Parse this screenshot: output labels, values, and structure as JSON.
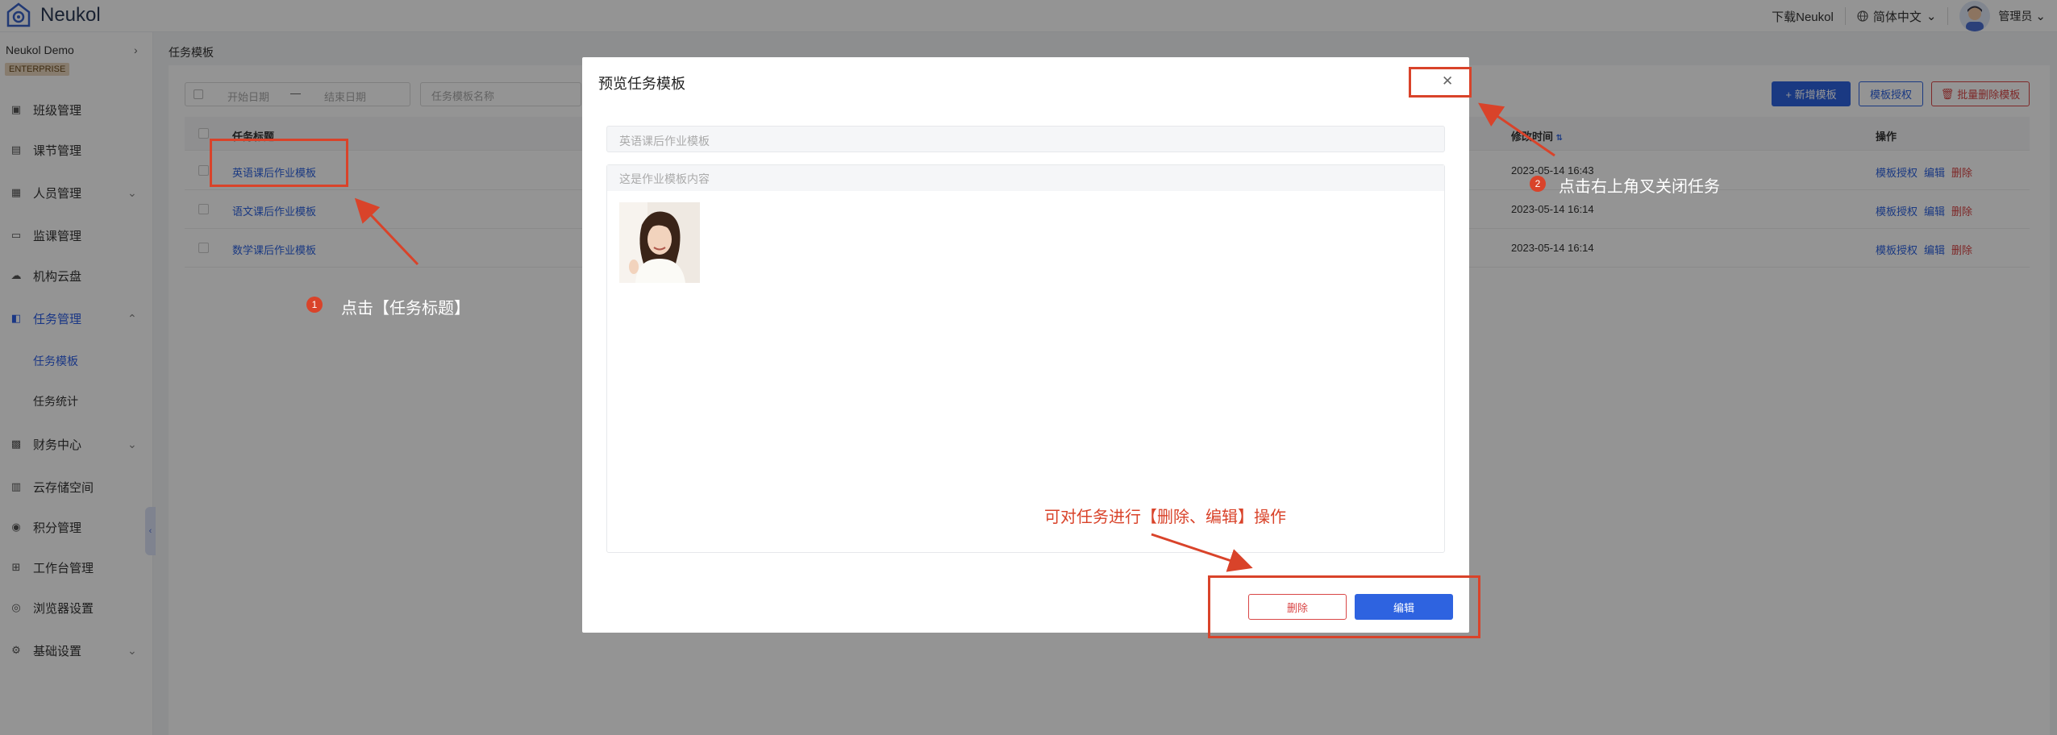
{
  "header": {
    "app_name": "Neukol",
    "download": "下载Neukol",
    "language": "简体中文",
    "user": "管理员"
  },
  "sidebar": {
    "org_name": "Neukol Demo",
    "edition": "ENTERPRISE",
    "items": [
      {
        "label": "班级管理",
        "icon": "class-icon"
      },
      {
        "label": "课节管理",
        "icon": "lesson-icon"
      },
      {
        "label": "人员管理",
        "icon": "people-icon"
      },
      {
        "label": "监课管理",
        "icon": "monitor-icon"
      },
      {
        "label": "机构云盘",
        "icon": "cloud-icon"
      },
      {
        "label": "任务管理",
        "icon": "task-icon"
      },
      {
        "label": "任务模板",
        "icon": ""
      },
      {
        "label": "任务统计",
        "icon": ""
      },
      {
        "label": "财务中心",
        "icon": "finance-icon"
      },
      {
        "label": "云存储空间",
        "icon": "storage-icon"
      },
      {
        "label": "积分管理",
        "icon": "points-icon"
      },
      {
        "label": "工作台管理",
        "icon": "grid-icon"
      },
      {
        "label": "浏览器设置",
        "icon": "browser-icon"
      },
      {
        "label": "基础设置",
        "icon": "settings-icon"
      }
    ]
  },
  "page": {
    "breadcrumb": "任务模板",
    "start_date_placeholder": "开始日期",
    "end_date_placeholder": "结束日期",
    "range_separator": "—",
    "name_placeholder": "任务模板名称",
    "new_button": "+ 新增模板",
    "grant_button": "模板授权",
    "bulk_delete_button": "批量删除模板"
  },
  "table": {
    "columns": [
      "任务标题",
      "修改时间",
      "操作"
    ],
    "rows": [
      {
        "title": "英语课后作业模板",
        "time": "2023-05-14 16:43",
        "ops": [
          "模板授权",
          "编辑",
          "删除"
        ]
      },
      {
        "title": "语文课后作业模板",
        "time": "2023-05-14 16:14",
        "ops": [
          "模板授权",
          "编辑",
          "删除"
        ]
      },
      {
        "title": "数学课后作业模板",
        "time": "2023-05-14 16:14",
        "ops": [
          "模板授权",
          "编辑",
          "删除"
        ]
      }
    ]
  },
  "modal": {
    "title": "预览任务模板",
    "task_title": "英语课后作业模板",
    "content": "这是作业模板内容",
    "delete_button": "删除",
    "edit_button": "编辑"
  },
  "annotations": {
    "step1_num": "1",
    "step1_text": "点击【任务标题】",
    "step2_num": "2",
    "step2_text": "点击右上角叉关闭任务",
    "ops_text": "可对任务进行【删除、编辑】操作"
  },
  "colors": {
    "primary": "#2e63e0",
    "danger": "#d94646",
    "annotation": "#d9432a"
  }
}
